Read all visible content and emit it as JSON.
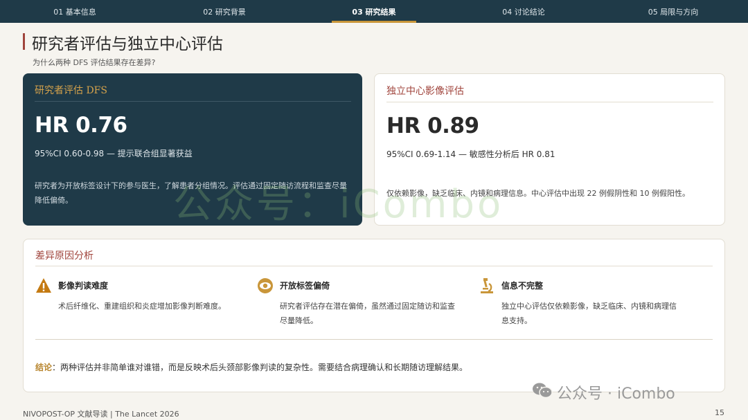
{
  "nav": {
    "tabs": [
      {
        "label": "01 基本信息"
      },
      {
        "label": "02 研究背景"
      },
      {
        "label": "03 研究结果"
      },
      {
        "label": "04 讨论结论"
      },
      {
        "label": "05 局限与方向"
      }
    ],
    "active_index": 2
  },
  "page": {
    "title": "研究者评估与独立中心评估",
    "subtitle": "为什么两种 DFS 评估结果存在差异?"
  },
  "investigator_card": {
    "heading": "研究者评估 DFS",
    "hr": "HR 0.76",
    "ci": "95%CI 0.60-0.98 — 提示联合组显著获益",
    "description": "研究者为开放标签设计下的参与医生，了解患者分组情况。评估通过固定随访流程和监查尽量降低偏倚。"
  },
  "central_card": {
    "heading": "独立中心影像评估",
    "hr": "HR 0.89",
    "ci": "95%CI 0.69-1.14 — 敏感性分析后 HR 0.81",
    "description": "仅依赖影像，缺乏临床、内镜和病理信息。中心评估中出现 22 例假阴性和 10 例假阳性。"
  },
  "analysis": {
    "heading": "差异原因分析",
    "reasons": [
      {
        "icon": "warning-icon",
        "title": "影像判读难度",
        "text": "术后纤维化、重建组织和炎症增加影像判断难度。"
      },
      {
        "icon": "eye-icon",
        "title": "开放标签偏倚",
        "text": "研究者评估存在潜在偏倚，虽然通过固定随访和监查尽量降低。"
      },
      {
        "icon": "microscope-icon",
        "title": "信息不完整",
        "text": "独立中心评估仅依赖影像，缺乏临床、内镜和病理信息支持。"
      }
    ],
    "conclusion_lead": "结论",
    "conclusion_text": "：两种评估并非简单谁对谁错，而是反映术后头颈部影像判读的复杂性。需要结合病理确认和长期随访理解结果。"
  },
  "footer": {
    "left": "NIVOPOST-OP 文献导读 | The Lancet 2026",
    "page_number": "15"
  },
  "watermarks": {
    "center": "公众号：iCombo",
    "bottom_right": "公众号 · iCombo"
  },
  "colors": {
    "nav_bg": "#1f3a48",
    "accent_gold": "#c9963a",
    "accent_red": "#a0443c",
    "dark_card": "#1f3a48"
  }
}
